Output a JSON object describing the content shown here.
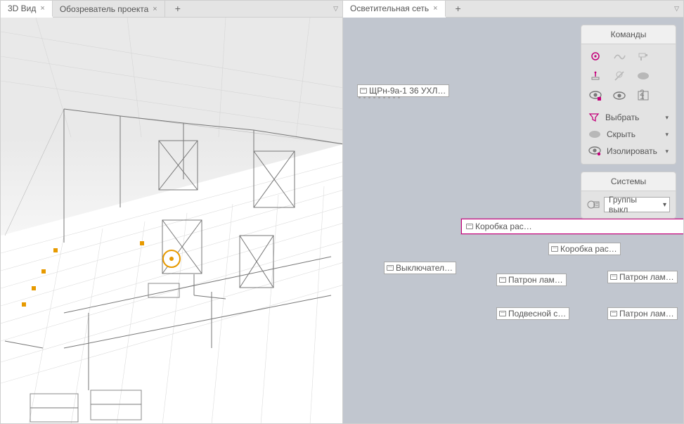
{
  "left_tabs": {
    "t1": "3D Вид",
    "t2": "Обозреватель проекта"
  },
  "right_tabs": {
    "t1": "Осветительная сеть"
  },
  "canvas2": {
    "label_panel": "ЩРн-9а-1 36 УХЛ…",
    "label_box_sel": "Коробка рас…",
    "label_box2": "Коробка рас…",
    "label_switch": "Выключател…",
    "label_lamp1": "Патрон лам…",
    "label_lamp2": "Патрон лам…",
    "label_pendant": "Подвесной с…",
    "label_lamp3": "Патрон лам…"
  },
  "panel": {
    "commands_header": "Команды",
    "cmd_select": "Выбрать",
    "cmd_hide": "Скрыть",
    "cmd_isolate": "Изолировать",
    "systems_header": "Системы",
    "systems_value": "Группы выкл"
  },
  "colors": {
    "accent": "#c4007a"
  }
}
